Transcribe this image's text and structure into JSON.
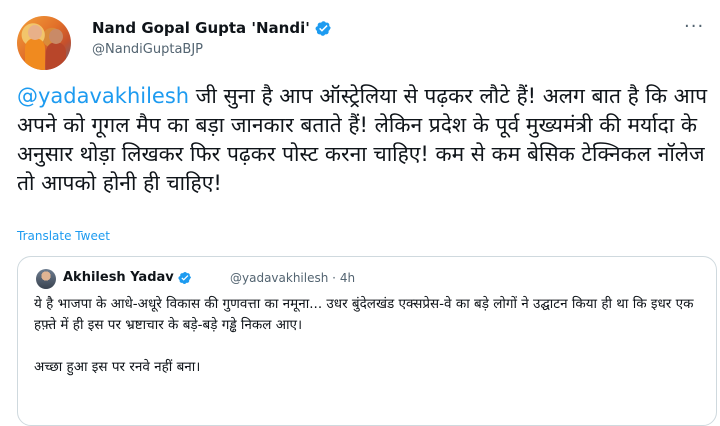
{
  "author": {
    "name": "Nand Gopal Gupta 'Nandi'",
    "handle": "@NandiGuptaBJP"
  },
  "tweet": {
    "mention": "@yadavakhilesh",
    "text": " जी सुना है आप ऑस्ट्रेलिया से पढ़कर लौटे हैं! अलग बात है कि आप अपने को गूगल मैप का बड़ा जानकार बताते हैं! लेकिन प्रदेश के पूर्व मुख्यमंत्री की मर्यादा के अनुसार थोड़ा लिखकर फिर पढ़कर पोस्ट करना चाहिए! कम से कम बेसिक टेक्निकल नॉलेज तो आपको होनी ही चाहिए!",
    "translate_label": "Translate Tweet"
  },
  "quoted": {
    "name": "Akhilesh Yadav",
    "handle": "@yadavakhilesh",
    "separator": "·",
    "time": "4h",
    "paragraph1": "ये है भाजपा के आधे-अधूरे विकास की गुणवत्ता का नमूना... उधर बुंदेलखंड एक्सप्रेस-वे का बड़े लोगों ने उद्घाटन किया ही था कि इधर एक हफ़्ते में ही इस पर भ्रष्टाचार के बड़े-बड़े गड्ढे निकल आए।",
    "paragraph2": "अच्छा हुआ इस पर रनवे नहीं बना।"
  },
  "icons": {
    "verified": "verified-badge-icon",
    "more": "more-options-icon"
  },
  "colors": {
    "link": "#1d9bf0",
    "text": "#0f1419",
    "secondary": "#536471",
    "border": "#cfd9de"
  }
}
